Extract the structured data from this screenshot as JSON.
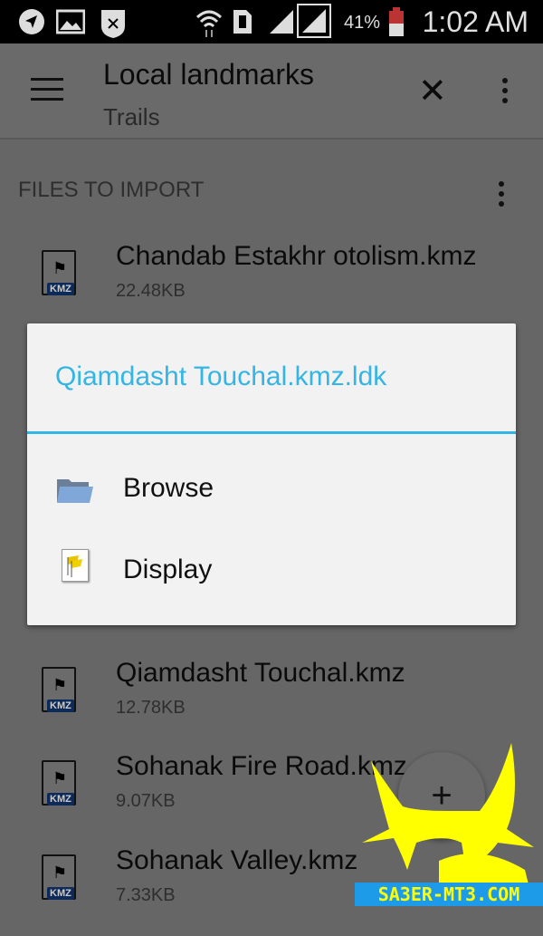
{
  "status_bar": {
    "icons": [
      "navigation-icon",
      "image-icon",
      "shield-x-icon",
      "wifi-icon",
      "sim-icon",
      "signal-icon",
      "signal-icon"
    ],
    "battery": "41%",
    "time": "1:02 AM"
  },
  "toolbar": {
    "title": "Local landmarks",
    "subtitle": "Trails",
    "menu_icon": "hamburger-icon",
    "close_icon": "close-icon",
    "overflow_icon": "more-vert-icon"
  },
  "section": {
    "title": "FILES TO IMPORT"
  },
  "files": [
    {
      "name": "Chandab Estakhr otolism.kmz",
      "size": "22.48KB"
    },
    {
      "name": "Qiamdasht Touchal.kmz",
      "size": "12.78KB"
    },
    {
      "name": "Sohanak Fire Road.kmz",
      "size": "9.07KB"
    },
    {
      "name": "Sohanak Valley.kmz",
      "size": "7.33KB"
    }
  ],
  "file_badge": "KMZ",
  "dialog": {
    "title": "Qiamdasht Touchal.kmz.ldk",
    "accent": "#33b5e5",
    "options": [
      {
        "label": "Browse",
        "icon": "folder-icon"
      },
      {
        "label": "Display",
        "icon": "map-flags-icon"
      }
    ]
  },
  "fab": {
    "label": "+"
  },
  "watermark": {
    "text": "SA3ER-MT3.COM",
    "color": "#ffff00"
  }
}
